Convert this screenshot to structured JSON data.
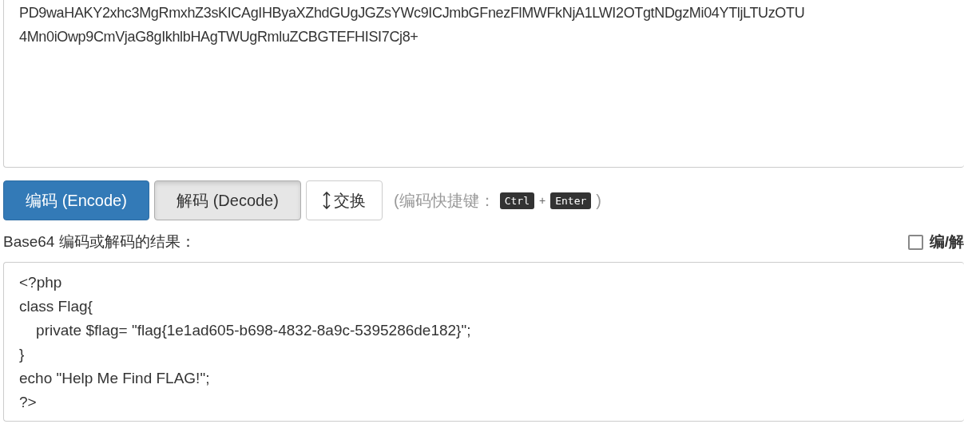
{
  "input": {
    "value": [
      "PD9waHAKY2xhc3MgRmxhZ3sKICAgIHByaXZhdGUgJGZsYWc9ICJmbGFnezFlMWFkNjA1LWI2OTgtNDgzMi04YTljLTUzOTU",
      "4Mn0iOwp9CmVjaG8gIkhlbHAgTWUgRmluZCBGTEFHISI7Cj8+"
    ]
  },
  "buttons": [
    {
      "label": "编码 (Encode)",
      "kind": "primary"
    },
    {
      "label": "解码 (Decode)",
      "kind": "pressed"
    },
    {
      "label": "交换",
      "kind": "swap"
    }
  ],
  "shortcut": {
    "prefix": "(编码快捷键：",
    "keys": [
      "Ctrl",
      "Enter"
    ],
    "plus": "+",
    "suffix": ")"
  },
  "result_label": "Base64 编码或解码的结果：",
  "option": {
    "label": "编/解",
    "checked": false
  },
  "output": {
    "lines": [
      "<?php",
      "class Flag{",
      "    private $flag= \"flag{1e1ad605-b698-4832-8a9c-5395286de182}\";",
      "}",
      "echo \"Help Me Find FLAG!\";",
      "?>"
    ]
  }
}
